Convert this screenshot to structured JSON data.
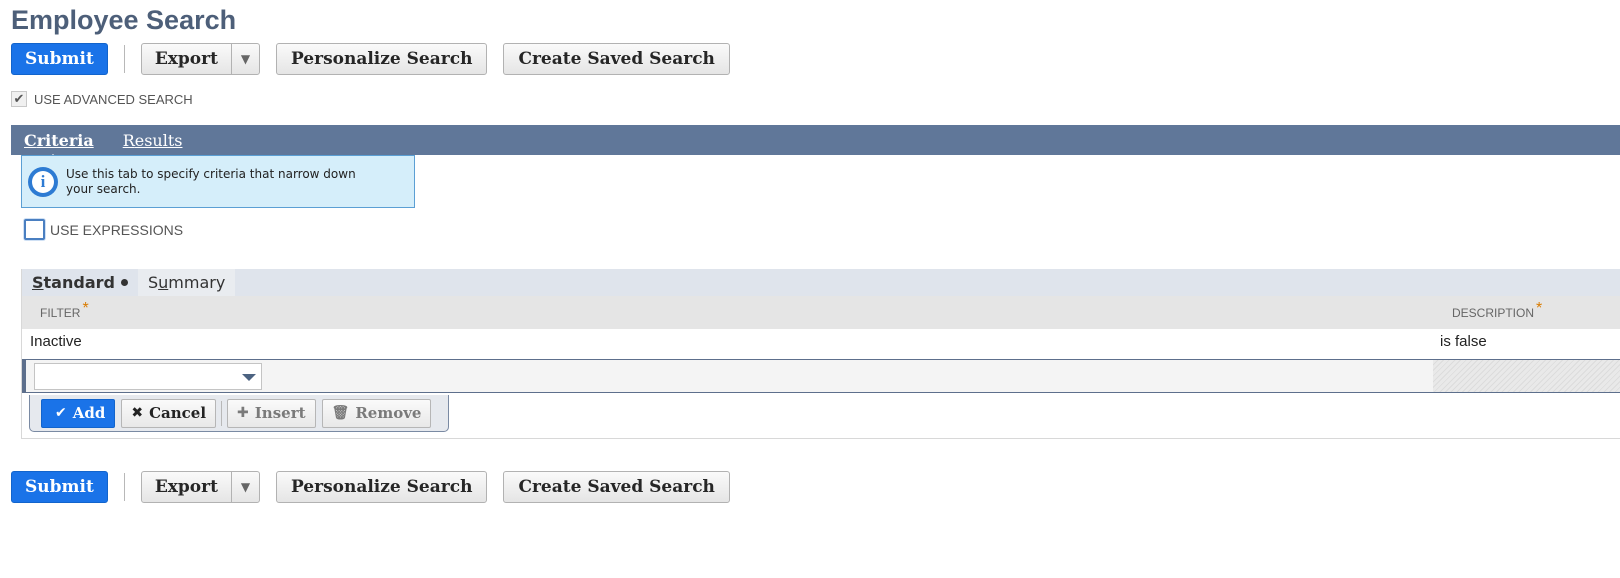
{
  "page": {
    "title": "Employee Search"
  },
  "toolbar": {
    "submit_label": "Submit",
    "export_label": "Export",
    "export_arrow": "▼",
    "personalize_label": "Personalize Search",
    "create_saved_label": "Create Saved Search"
  },
  "advanced": {
    "label": "USE ADVANCED SEARCH",
    "checked": true,
    "check_glyph": "✔"
  },
  "tabs": {
    "criteria": {
      "first": "C",
      "rest": "riteria"
    },
    "results": {
      "first": "R",
      "rest": "esults"
    }
  },
  "info": {
    "text": "Use this tab to specify criteria that narrow down your search.",
    "icon_glyph": "i"
  },
  "expressions": {
    "label": "USE EXPRESSIONS",
    "checked": false
  },
  "subtabs": {
    "standard": {
      "first": "S",
      "rest": "tandard"
    },
    "summary": {
      "first": "S",
      "underlined": "u",
      "rest": "mmary"
    }
  },
  "table": {
    "columns": {
      "filter": "FILTER",
      "description": "DESCRIPTION",
      "required_mark": "*"
    },
    "rows": [
      {
        "filter": "Inactive",
        "description": "is false"
      }
    ],
    "edit_row": {
      "filter_value": ""
    }
  },
  "actions": {
    "add_label": "Add",
    "cancel_label": "Cancel",
    "insert_label": "Insert",
    "remove_label": "Remove",
    "add_icon": "✔",
    "cancel_icon": "✖",
    "insert_icon": "✚",
    "remove_icon": "🗑"
  },
  "colors": {
    "primary": "#1a73e8",
    "tabbar": "#607799",
    "title": "#4d5f79",
    "required": "#d97b00",
    "info_bg": "#d5eefa"
  }
}
